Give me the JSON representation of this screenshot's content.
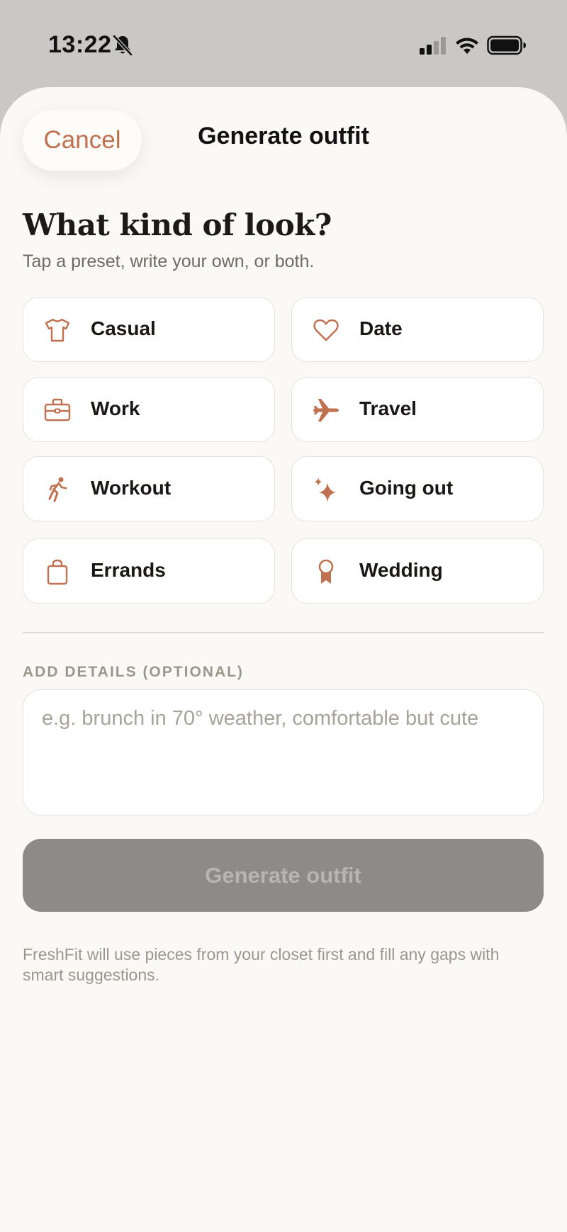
{
  "status_bar": {
    "time": "13:22"
  },
  "sheet": {
    "cancel_label": "Cancel",
    "title": "Generate outfit"
  },
  "prompt": {
    "heading": "What kind of look?",
    "subheading": "Tap a preset, write your own, or both."
  },
  "presets": [
    {
      "label": "Casual",
      "icon": "tshirt-icon"
    },
    {
      "label": "Date",
      "icon": "heart-icon"
    },
    {
      "label": "Work",
      "icon": "briefcase-icon"
    },
    {
      "label": "Travel",
      "icon": "airplane-icon"
    },
    {
      "label": "Workout",
      "icon": "running-figure-icon"
    },
    {
      "label": "Going out",
      "icon": "sparkles-icon"
    },
    {
      "label": "Errands",
      "icon": "shopping-bag-icon"
    },
    {
      "label": "Wedding",
      "icon": "award-ribbon-icon"
    }
  ],
  "details": {
    "section_label": "ADD DETAILS (OPTIONAL)",
    "placeholder": "e.g. brunch in 70° weather, comfortable but cute",
    "value": ""
  },
  "generate_button": {
    "label": "Generate outfit",
    "enabled": false
  },
  "footnote": "FreshFit will use pieces from your closet first and fill any gaps with smart suggestions.",
  "colors": {
    "accent": "#c0714f",
    "sheet_background": "#faf9f6",
    "backdrop": "#c9c8c4",
    "button_disabled": "#8c8b87"
  }
}
